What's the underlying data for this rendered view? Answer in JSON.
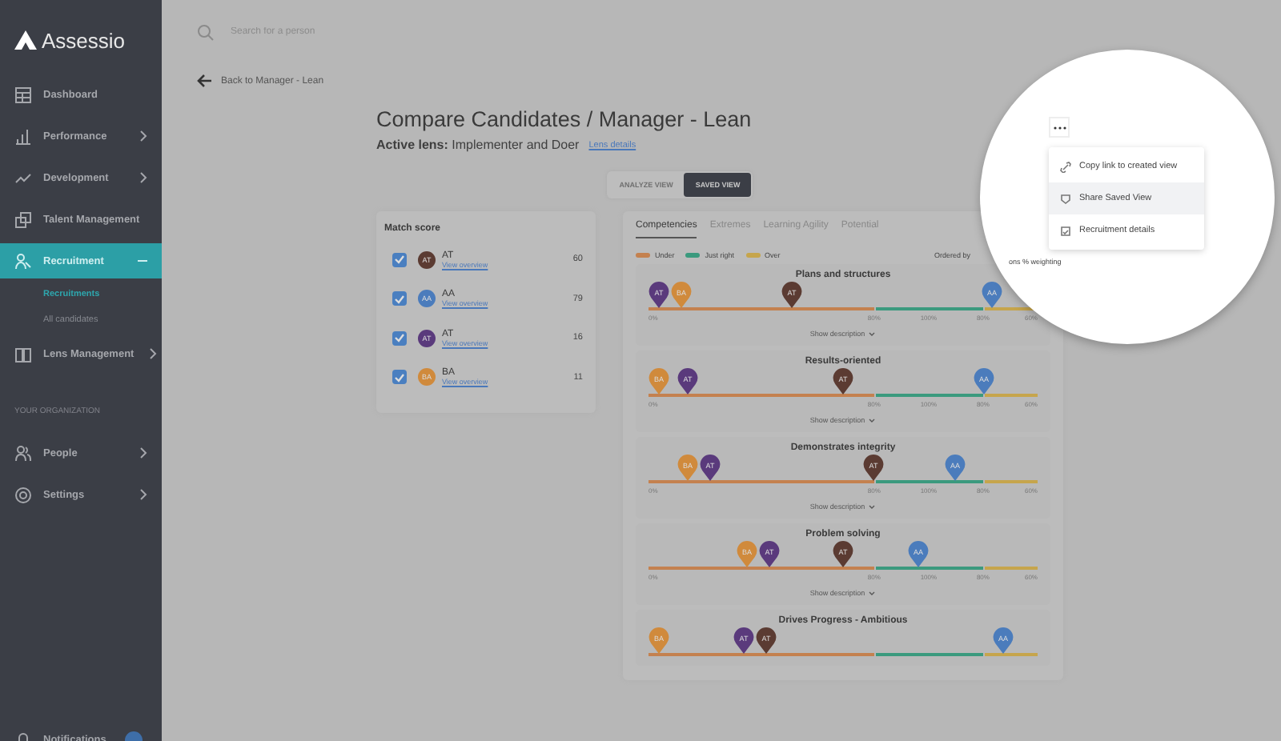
{
  "brand": "Assessio",
  "search": {
    "placeholder": "Search for a person"
  },
  "sidebar": {
    "items": [
      {
        "label": "Dashboard",
        "selected": false,
        "has_submenu": false,
        "expanded": false
      },
      {
        "label": "Performance",
        "selected": false,
        "has_submenu": true,
        "expanded": false
      },
      {
        "label": "Development",
        "selected": false,
        "has_submenu": true,
        "expanded": false
      },
      {
        "label": "Talent Management",
        "selected": false,
        "has_submenu": false,
        "expanded": false
      },
      {
        "label": "Recruitment",
        "selected": true,
        "has_submenu": true,
        "expanded": true,
        "children": [
          {
            "label": "Recruitments",
            "selected": true
          },
          {
            "label": "All candidates",
            "selected": false
          }
        ]
      },
      {
        "label": "Lens Management",
        "selected": false,
        "has_submenu": true,
        "expanded": false
      }
    ],
    "section": "YOUR ORGANIZATION",
    "org_items": [
      {
        "label": "People",
        "selected": false,
        "has_submenu": true,
        "expanded": false
      },
      {
        "label": "Settings",
        "selected": false,
        "has_submenu": true,
        "expanded": false
      }
    ],
    "notifications": {
      "label": "Notifications"
    }
  },
  "back_link": "Back to Manager - Lean",
  "title": "Compare Candidates / Manager - Lean",
  "active_lens": {
    "label": "Active lens:",
    "value": "Implementer and Doer",
    "link": "Lens details"
  },
  "views": [
    {
      "label": "ANALYZE VIEW",
      "selected": false
    },
    {
      "label": "SAVED VIEW",
      "selected": true
    }
  ],
  "match_score": {
    "title": "Match score",
    "candidates": [
      {
        "initials": "AT",
        "name": "AT",
        "link": "View overview",
        "score": "60",
        "checked": true,
        "color": "#5b3b32"
      },
      {
        "initials": "AA",
        "name": "AA",
        "link": "View overview",
        "score": "79",
        "checked": true,
        "color": "#4b7cbc"
      },
      {
        "initials": "AT",
        "name": "AT",
        "link": "View overview",
        "score": "16",
        "checked": true,
        "color": "#5a3a7c"
      },
      {
        "initials": "BA",
        "name": "BA",
        "link": "View overview",
        "score": "11",
        "checked": true,
        "color": "#d08a3c"
      }
    ]
  },
  "tabs": [
    {
      "label": "Competencies",
      "selected": true
    },
    {
      "label": "Extremes",
      "selected": false
    },
    {
      "label": "Learning Agility",
      "selected": false
    },
    {
      "label": "Potential",
      "selected": false
    }
  ],
  "legend": [
    {
      "label": "Under",
      "color": "#c4814f"
    },
    {
      "label": "Just right",
      "color": "#3b9a7e"
    },
    {
      "label": "Over",
      "color": "#c6a54c"
    }
  ],
  "ordered_by": "Ordered by",
  "ordered_by_magnified": "ons % weighting",
  "competencies": [
    {
      "title": "Plans and structures",
      "show_scale": true,
      "pins": [
        {
          "initials": "AT",
          "color": "#5a3a7c",
          "level": 0.0
        },
        {
          "initials": "BA",
          "color": "#d08a3c",
          "level": 0.06
        },
        {
          "initials": "AT",
          "color": "#5b3b32",
          "level": 0.36
        },
        {
          "initials": "AA",
          "color": "#4b7cbc",
          "level": 0.9
        }
      ],
      "scale": [
        "0%",
        "80%",
        "100%",
        "80%",
        "60%"
      ],
      "toggle": "Show description"
    },
    {
      "title": "Results-oriented",
      "show_scale": true,
      "pins": [
        {
          "initials": "BA",
          "color": "#d08a3c",
          "level": 0.0
        },
        {
          "initials": "AT",
          "color": "#5a3a7c",
          "level": 0.08
        },
        {
          "initials": "AT",
          "color": "#5b3b32",
          "level": 0.5
        },
        {
          "initials": "AA",
          "color": "#4b7cbc",
          "level": 0.88
        }
      ],
      "scale": [
        "0%",
        "80%",
        "100%",
        "80%",
        "60%"
      ],
      "toggle": "Show description"
    },
    {
      "title": "Demonstrates integrity",
      "show_scale": true,
      "pins": [
        {
          "initials": "BA",
          "color": "#d08a3c",
          "level": 0.08
        },
        {
          "initials": "AT",
          "color": "#5a3a7c",
          "level": 0.14
        },
        {
          "initials": "AT",
          "color": "#5b3b32",
          "level": 0.58
        },
        {
          "initials": "AA",
          "color": "#4b7cbc",
          "level": 0.8
        }
      ],
      "scale": [
        "0%",
        "80%",
        "100%",
        "80%",
        "60%"
      ],
      "toggle": "Show description"
    },
    {
      "title": "Problem solving",
      "show_scale": true,
      "pins": [
        {
          "initials": "BA",
          "color": "#d08a3c",
          "level": 0.24
        },
        {
          "initials": "AT",
          "color": "#5a3a7c",
          "level": 0.3
        },
        {
          "initials": "AT",
          "color": "#5b3b32",
          "level": 0.5
        },
        {
          "initials": "AA",
          "color": "#4b7cbc",
          "level": 0.7
        }
      ],
      "scale": [
        "0%",
        "80%",
        "100%",
        "80%",
        "60%"
      ],
      "toggle": "Show description"
    },
    {
      "title": "Drives Progress - Ambitious",
      "show_scale": false,
      "pins": [
        {
          "initials": "BA",
          "color": "#d08a3c",
          "level": 0.0
        },
        {
          "initials": "AT",
          "color": "#5a3a7c",
          "level": 0.23
        },
        {
          "initials": "AT",
          "color": "#5b3b32",
          "level": 0.29
        },
        {
          "initials": "AA",
          "color": "#4b7cbc",
          "level": 0.93
        }
      ]
    }
  ],
  "menu": {
    "items": [
      {
        "label": "Copy link to created view",
        "selected": false
      },
      {
        "label": "Share Saved View",
        "selected": true
      },
      {
        "label": "Recruitment details",
        "selected": false
      }
    ]
  }
}
